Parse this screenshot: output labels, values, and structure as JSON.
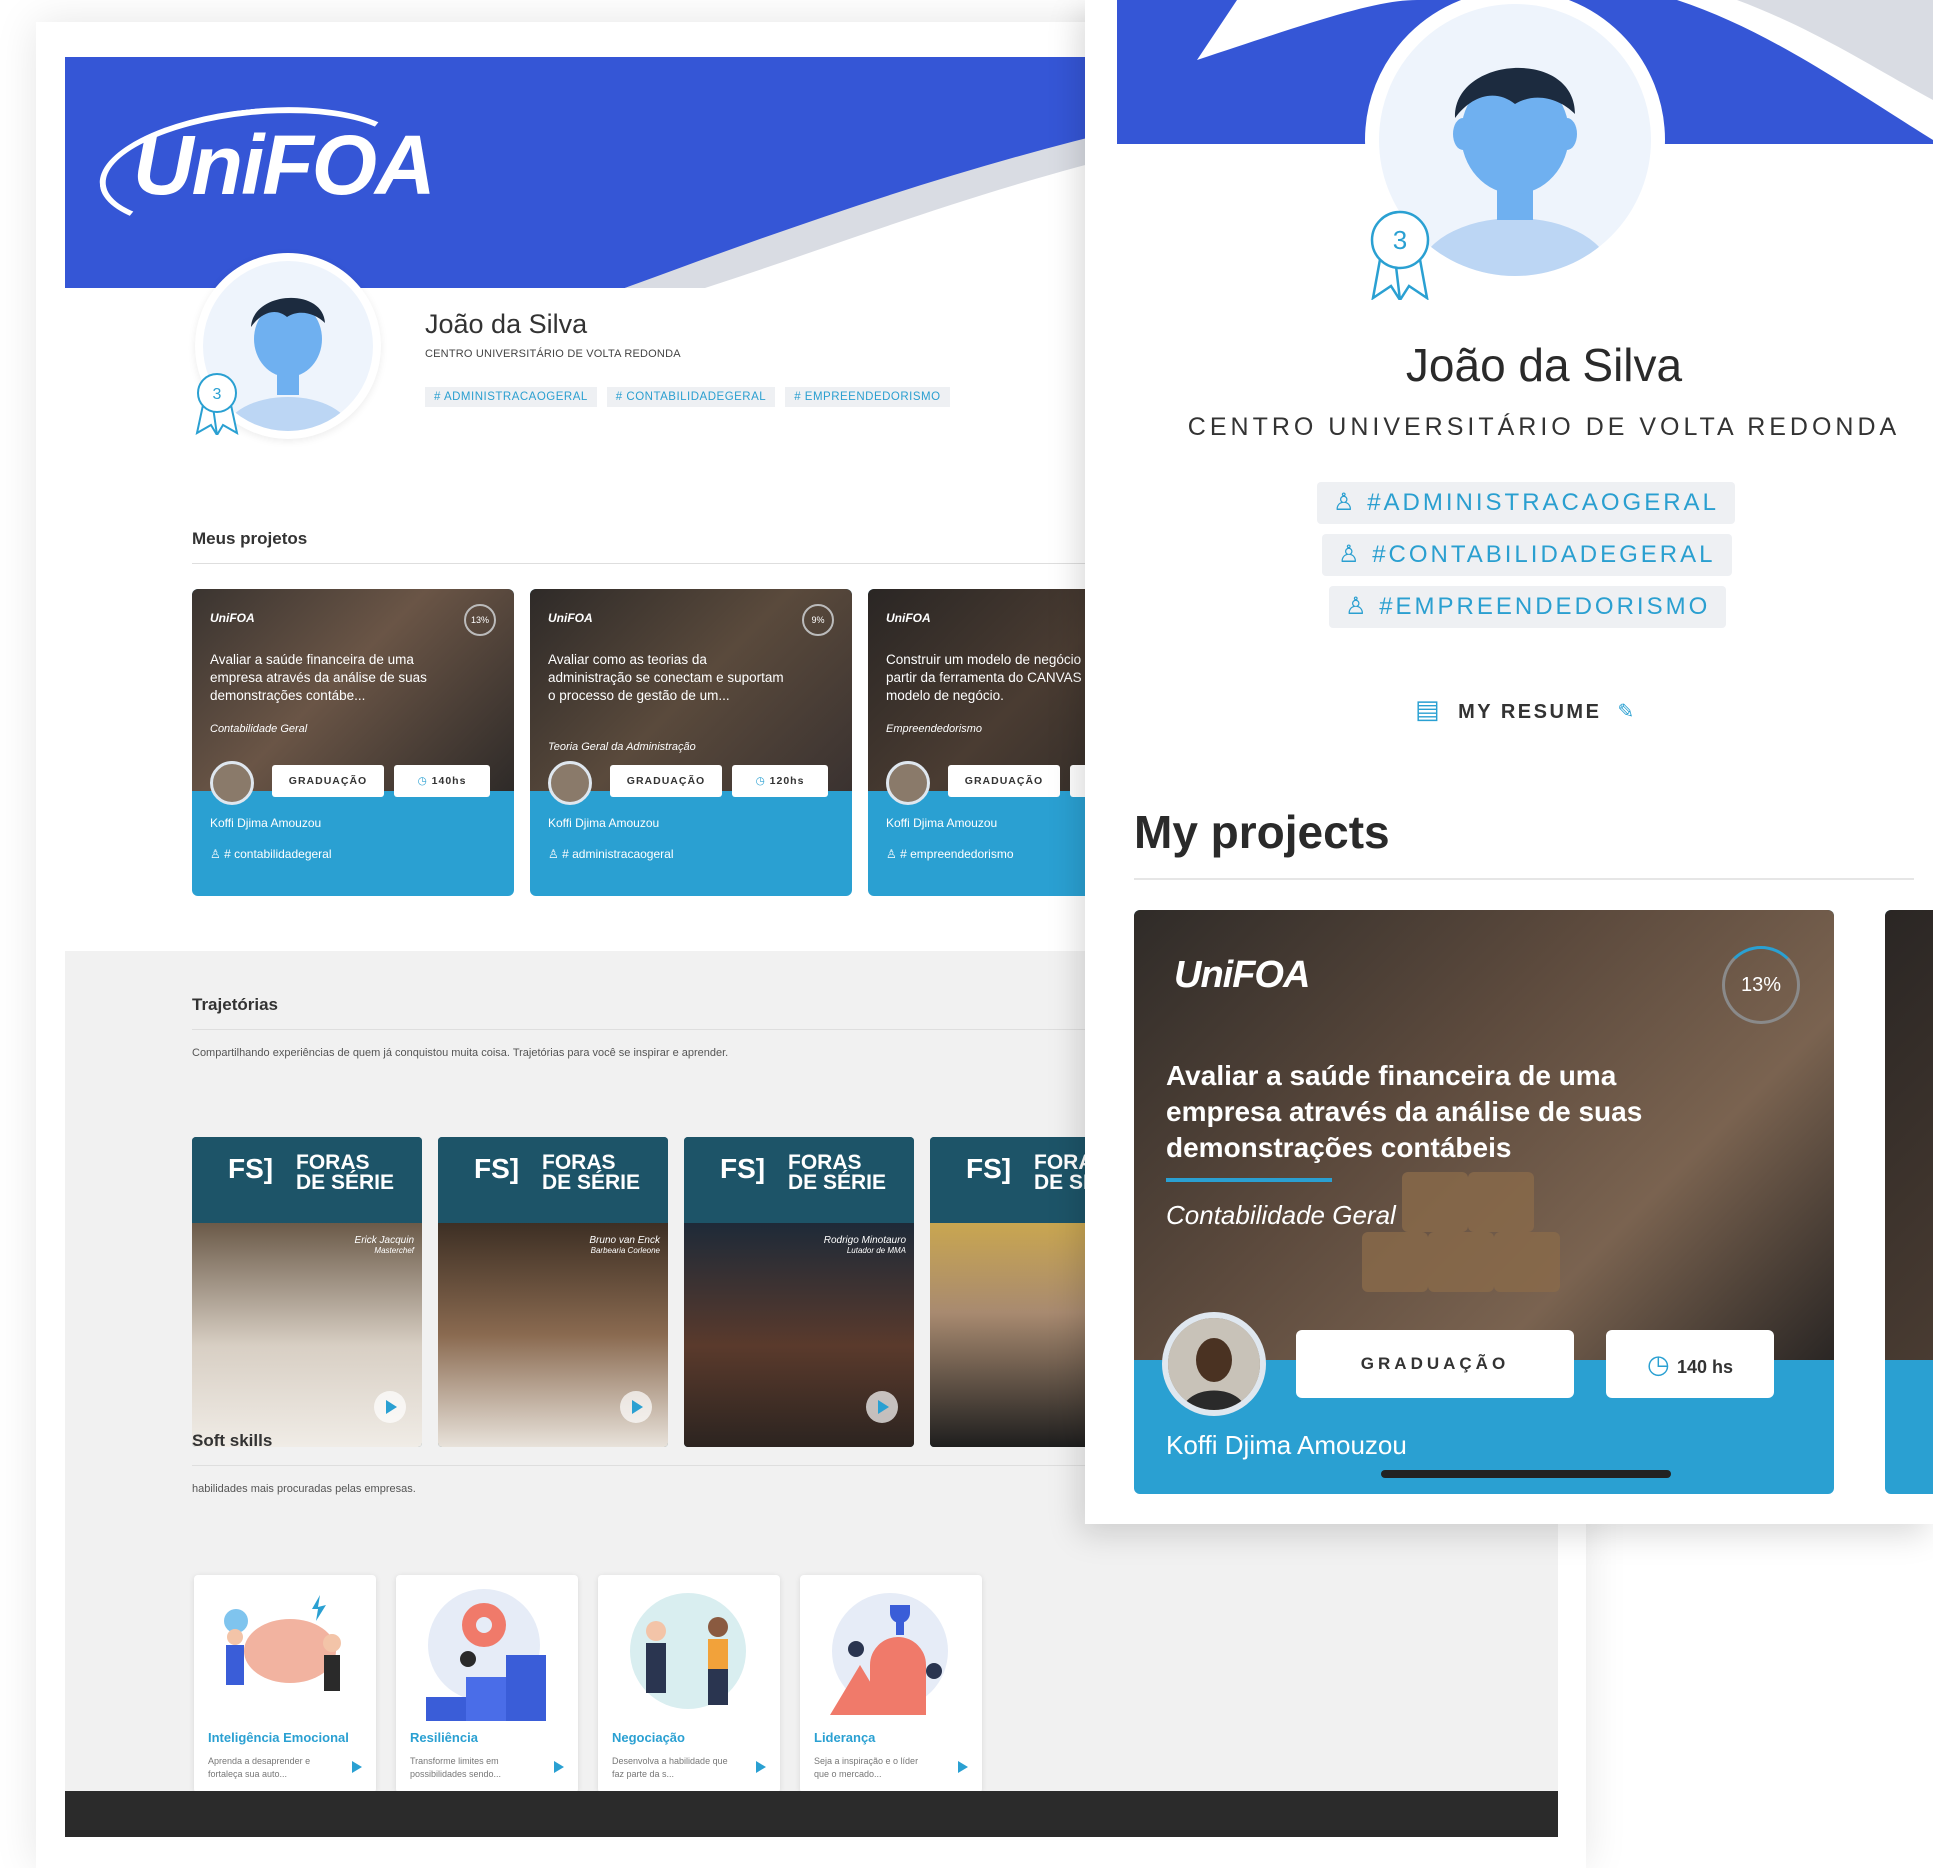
{
  "desktop": {
    "logo": "UniFOA",
    "profile": {
      "name": "João da Silva",
      "school": "CENTRO UNIVERSITÁRIO DE VOLTA REDONDA",
      "badge_count": "3",
      "tags": [
        "# ADMINISTRACAOGERAL",
        "# CONTABILIDADEGERAL",
        "# EMPREENDEDORISMO"
      ]
    },
    "projects": {
      "title": "Meus projetos",
      "items": [
        {
          "logo": "UniFOA",
          "progress": "13%",
          "title": "Avaliar a saúde financeira de uma empresa através da análise de suas demonstrações contábe...",
          "area": "Contabilidade Geral",
          "level": "GRADUAÇÃO",
          "hours": "140hs",
          "author": "Koffi Djima Amouzou",
          "tag": "# contabilidadegeral"
        },
        {
          "logo": "UniFOA",
          "progress": "9%",
          "title": "Avaliar como as teorias da administração se conectam e suportam o processo de gestão de um...",
          "area": "Teoria Geral da Administração",
          "level": "GRADUAÇÃO",
          "hours": "120hs",
          "author": "Koffi Djima Amouzou",
          "tag": "# administracaogeral"
        },
        {
          "logo": "UniFOA",
          "progress": "",
          "title": "Construir um modelo de negócio a partir da ferramenta do CANVAS modelo de negócio.",
          "area": "Empreendedorismo",
          "level": "GRADUAÇÃO",
          "hours": "",
          "author": "Koffi Djima Amouzou",
          "tag": "# empreendedorismo"
        }
      ]
    },
    "trajectories": {
      "title": "Trajetórias",
      "description": "Compartilhando experiências de quem já conquistou muita coisa. Trajetórias para você se inspirar e aprender.",
      "brand_mark": "FS]",
      "brand_line1": "FORAS",
      "brand_line2": "DE SÉRIE",
      "items": [
        {
          "person": "Erick Jacquin",
          "role": "Masterchef"
        },
        {
          "person": "Bruno van Enck",
          "role": "Barbearia Corleone"
        },
        {
          "person": "Rodrigo Minotauro",
          "role": "Lutador de MMA"
        },
        {
          "person": "",
          "role": ""
        }
      ]
    },
    "soft_skills": {
      "title": "Soft skills",
      "description": "habilidades mais procuradas pelas empresas.",
      "items": [
        {
          "title": "Inteligência Emocional",
          "desc": "Aprenda a desaprender e fortaleça sua auto..."
        },
        {
          "title": "Resiliência",
          "desc": "Transforme limites em possibilidades sendo..."
        },
        {
          "title": "Negociação",
          "desc": "Desenvolva a habilidade que faz parte da s..."
        },
        {
          "title": "Liderança",
          "desc": "Seja a inspiração e o líder que o mercado..."
        }
      ]
    }
  },
  "mobile": {
    "profile": {
      "name": "João da Silva",
      "school": "CENTRO UNIVERSITÁRIO DE VOLTA REDONDA",
      "badge_count": "3",
      "tags": [
        "#ADMINISTRACAOGERAL",
        "#CONTABILIDADEGERAL",
        "#EMPREENDEDORISMO"
      ]
    },
    "resume_label": "MY RESUME",
    "projects_title": "My projects",
    "card": {
      "logo": "UniFOA",
      "progress": "13%",
      "title": "Avaliar a saúde financeira de uma empresa através da análise de suas demonstrações contábeis",
      "area": "Contabilidade Geral",
      "level": "GRADUAÇÃO",
      "hours": "140 hs",
      "author": "Koffi Djima Amouzou"
    }
  },
  "colors": {
    "brand_blue": "#3556d6",
    "accent_cyan": "#2aa0d2",
    "footer": "#2b2b2b"
  }
}
